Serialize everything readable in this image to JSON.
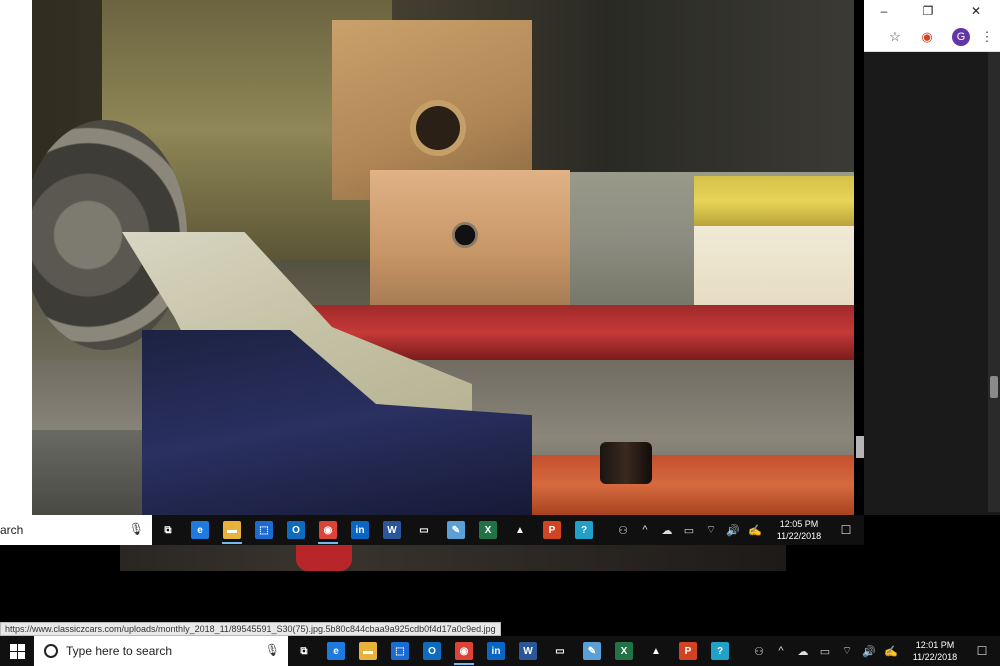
{
  "desktop": {
    "photo": {
      "subject": "car-rocker-panel-repair-photo"
    },
    "chrome": {
      "window_controls": {
        "minimize": "–",
        "maximize": "❐",
        "close": "✕"
      },
      "toolbar": {
        "bookmark_icon": "☆",
        "avatar_letter": "G",
        "menu_icon": "⋮"
      }
    },
    "status_url": "https://www.classiczcars.com/uploads/monthly_2018_11/89545591_S30(75).jpg.5b80c844cbaa9a925cdb0f4d17a0c9ed.jpg"
  },
  "taskbar_upper": {
    "search_text": "arch",
    "mic_icon": "🎙",
    "apps": [
      {
        "name": "task-view",
        "glyph": "⧉",
        "color": "#101010"
      },
      {
        "name": "edge",
        "glyph": "e",
        "color": "#1f7ae0"
      },
      {
        "name": "file-explorer",
        "glyph": "▬",
        "color": "#e8b33a",
        "active": true
      },
      {
        "name": "store",
        "glyph": "⬚",
        "color": "#1b6bd1"
      },
      {
        "name": "outlook",
        "glyph": "O",
        "color": "#0f6cbd"
      },
      {
        "name": "chrome",
        "glyph": "◉",
        "color": "#db4437",
        "active": true
      },
      {
        "name": "linkedin",
        "glyph": "in",
        "color": "#0a66c2"
      },
      {
        "name": "word",
        "glyph": "W",
        "color": "#2b579a"
      },
      {
        "name": "window-app",
        "glyph": "▭",
        "color": "#101010"
      },
      {
        "name": "paint",
        "glyph": "✎",
        "color": "#5aa0d6"
      },
      {
        "name": "excel",
        "glyph": "X",
        "color": "#217346"
      },
      {
        "name": "photos",
        "glyph": "▲",
        "color": "#101010"
      },
      {
        "name": "powerpoint",
        "glyph": "P",
        "color": "#d04423"
      },
      {
        "name": "help",
        "glyph": "?",
        "color": "#21a0c8"
      }
    ],
    "tray": [
      "⚇",
      "^",
      "☁",
      "▭",
      "⌔",
      "🔊",
      "✍"
    ],
    "time": "12:05 PM",
    "date": "11/22/2018",
    "notification_icon": "☐"
  },
  "taskbar_lower": {
    "search_placeholder": "Type here to search",
    "mic_icon": "🎙",
    "apps": [
      {
        "name": "task-view",
        "glyph": "⧉",
        "color": "#101010"
      },
      {
        "name": "edge",
        "glyph": "e",
        "color": "#1f7ae0"
      },
      {
        "name": "file-explorer",
        "glyph": "▬",
        "color": "#e8b33a"
      },
      {
        "name": "store",
        "glyph": "⬚",
        "color": "#1b6bd1"
      },
      {
        "name": "outlook",
        "glyph": "O",
        "color": "#0f6cbd"
      },
      {
        "name": "chrome",
        "glyph": "◉",
        "color": "#db4437",
        "active": true
      },
      {
        "name": "linkedin",
        "glyph": "in",
        "color": "#0a66c2"
      },
      {
        "name": "word",
        "glyph": "W",
        "color": "#2b579a"
      },
      {
        "name": "window-app",
        "glyph": "▭",
        "color": "#101010"
      },
      {
        "name": "paint",
        "glyph": "✎",
        "color": "#5aa0d6"
      },
      {
        "name": "excel",
        "glyph": "X",
        "color": "#217346"
      },
      {
        "name": "photos",
        "glyph": "▲",
        "color": "#101010"
      },
      {
        "name": "powerpoint",
        "glyph": "P",
        "color": "#d04423"
      },
      {
        "name": "help",
        "glyph": "?",
        "color": "#21a0c8"
      }
    ],
    "tray": [
      "⚇",
      "^",
      "☁",
      "▭",
      "⌔",
      "🔊",
      "✍"
    ],
    "time": "12:01 PM",
    "date": "11/22/2018",
    "notification_icon": "☐"
  }
}
